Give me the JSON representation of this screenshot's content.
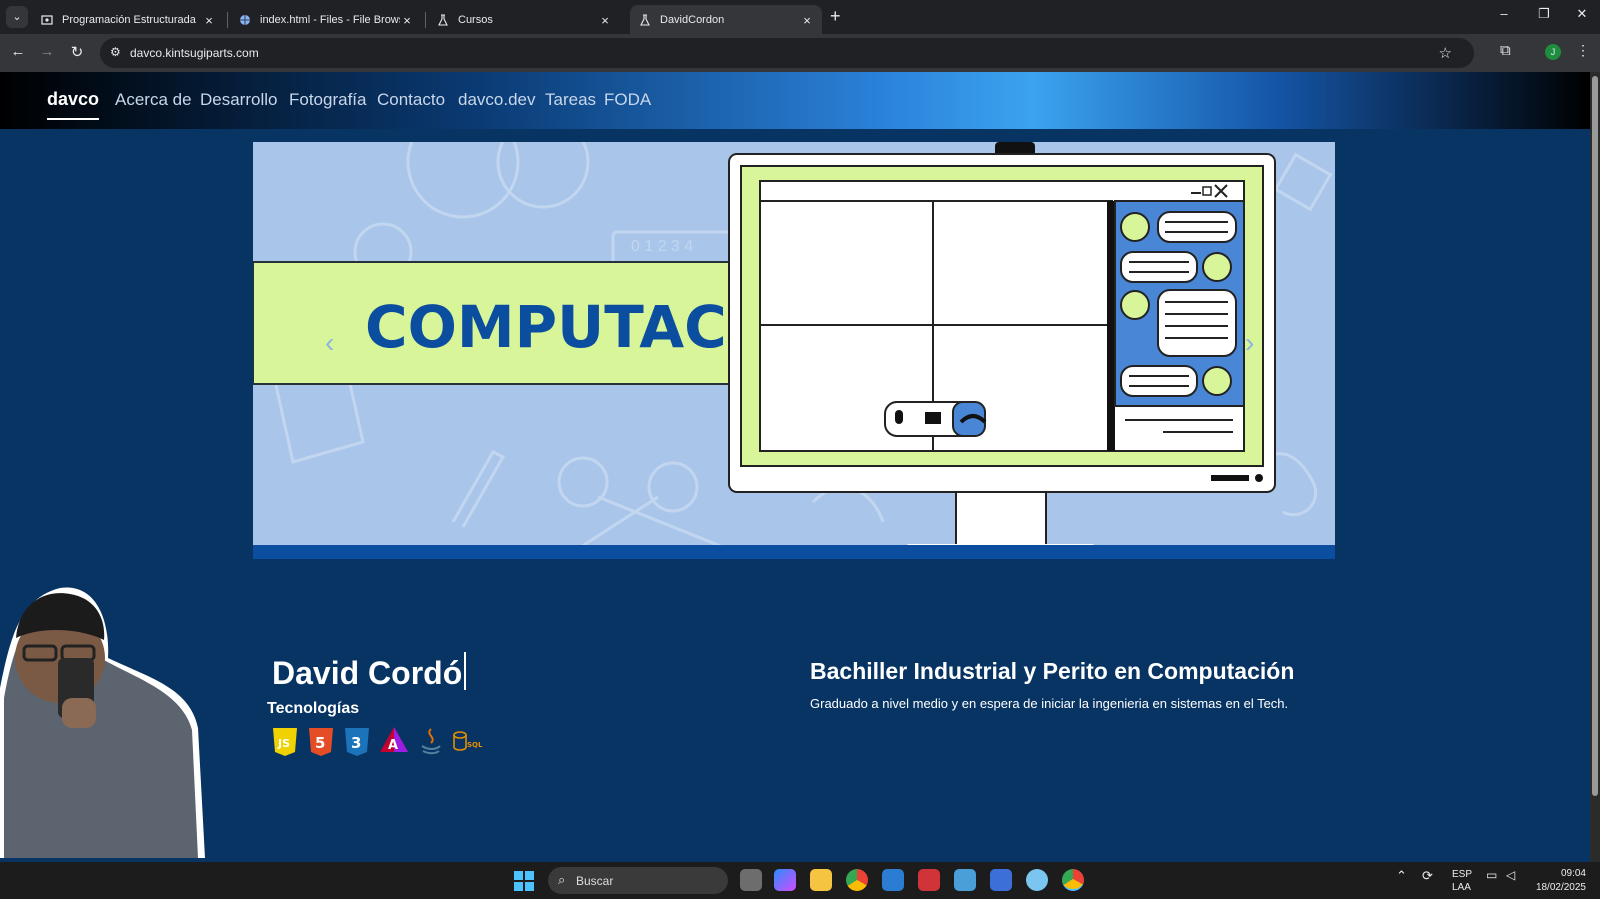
{
  "browser": {
    "tabs": [
      {
        "title": "Programación Estructurada",
        "icon": "classroom-icon"
      },
      {
        "title": "index.html - Files - File Browser",
        "icon": "globe-icon"
      },
      {
        "title": "Cursos",
        "icon": "flask-icon"
      },
      {
        "title": "DavidCordon",
        "icon": "flask-icon",
        "active": true
      }
    ],
    "url": "davco.kintsugiparts.com",
    "profile_initial": "J"
  },
  "site": {
    "brand": "davco",
    "nav": [
      "Acerca de",
      "Desarrollo",
      "Fotografía",
      "Contacto",
      "davco.dev",
      "Tareas",
      "FODA"
    ],
    "hero": {
      "banner_text": "COMPUTACIÓN",
      "ruler_digits": "0 1 2 3 4",
      "colors": {
        "background": "#a9c6ea",
        "banner": "#d8f59a",
        "banner_text": "#0b4d9e",
        "screen": "#d8f59a",
        "chat_panel": "#4a86d6"
      }
    },
    "profile": {
      "name": "David Cordó",
      "tech_label": "Tecnologías",
      "technologies": [
        {
          "name": "JavaScript",
          "icon": "js-icon",
          "color": "#f0d200",
          "glyph": "JS"
        },
        {
          "name": "HTML5",
          "icon": "html5-icon",
          "color": "#e44d26",
          "glyph": "5"
        },
        {
          "name": "CSS3",
          "icon": "css3-icon",
          "color": "#1b73ba",
          "glyph": "3"
        },
        {
          "name": "Angular",
          "icon": "angular-icon",
          "color": "#c3002f",
          "glyph": "A"
        },
        {
          "name": "Java",
          "icon": "java-icon",
          "color": "#5382a1",
          "glyph": "java"
        },
        {
          "name": "SQL",
          "icon": "sql-icon",
          "color": "#e48e00",
          "glyph": "SQL"
        }
      ],
      "degree": "Bachiller Industrial y Perito en Computación",
      "description": "Graduado a nivel medio y en espera de iniciar la ingenieria en sistemas en el Tech."
    }
  },
  "taskbar": {
    "search_label": "Buscar",
    "tray_lang": "ESP",
    "tray_layout": "LAA",
    "time": "09:04",
    "date": "18/02/2025"
  }
}
